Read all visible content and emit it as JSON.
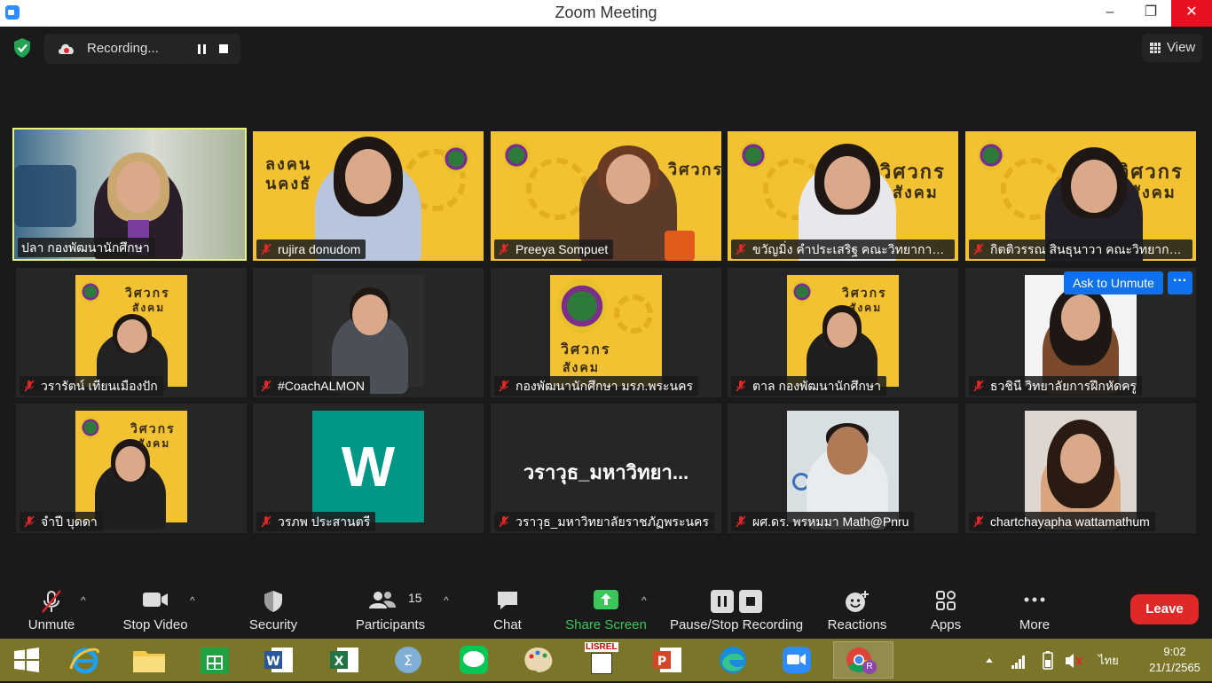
{
  "window": {
    "title": "Zoom Meeting",
    "minimize": "–",
    "maximize": "❐",
    "close": "✕"
  },
  "recording": {
    "label": "Recording..."
  },
  "view_button": {
    "label": "View"
  },
  "tiles": [
    {
      "name": "ปลา  กองพัฒนานักศึกษา",
      "muted": false,
      "active": true
    },
    {
      "name": "rujira donudom",
      "muted": true
    },
    {
      "name": "Preeya Sompuet",
      "muted": true
    },
    {
      "name": "ขวัญมิ่ง คำประเสริฐ คณะวิทยาการจัด...",
      "muted": true
    },
    {
      "name": "กิตติวรรณ สินธุนาวา คณะวิทยาการจั...",
      "muted": true
    },
    {
      "name": "วรารัตน์ เทียนเมืองปัก",
      "muted": true
    },
    {
      "name": "#CoachALMON",
      "muted": true
    },
    {
      "name": "กองพัฒนานักศึกษา มรภ.พระนคร",
      "muted": true
    },
    {
      "name": "ตาล กองพัฒนานักศึกษา",
      "muted": true
    },
    {
      "name": "ธวชินี  วิทยาลัยการฝึกหัดครู",
      "muted": true
    },
    {
      "name": "จำปี บุดดา",
      "muted": true
    },
    {
      "name": "วรภพ ประสานตรี",
      "muted": true,
      "avatar_letter": "W"
    },
    {
      "name": "วราวุธ_มหาวิทยาลัยราชภัฏพระนคร",
      "muted": true,
      "big_name": "วราวุธ_มหาวิทยา..."
    },
    {
      "name": "ผศ.ดร. พรหมมา Math@Pnru",
      "muted": true
    },
    {
      "name": "chartchayapha wattamathum",
      "muted": true
    }
  ],
  "ask_to_unmute": {
    "label": "Ask to Unmute",
    "more": "···"
  },
  "backgrounds": {
    "brand_1": "วิศวกร",
    "brand_2": "สังคม",
    "brand_3": "ลงคน",
    "brand_4": "นคงธั"
  },
  "toolbar": {
    "unmute": "Unmute",
    "stop_video": "Stop Video",
    "security": "Security",
    "participants": "Participants",
    "participants_count": "15",
    "chat": "Chat",
    "share_screen": "Share Screen",
    "pause_stop_recording": "Pause/Stop Recording",
    "reactions": "Reactions",
    "apps": "Apps",
    "more": "More",
    "leave": "Leave",
    "caret": "^"
  },
  "taskbar": {
    "language": "ไทย",
    "time": "9:02",
    "date": "21/1/2565",
    "lisrel_label": "LISREL",
    "chrome_badge": "R"
  },
  "colors": {
    "accent": "#0e72ed",
    "leave": "#e02828",
    "share": "#3cc65a",
    "active_border": "#e8f37a",
    "taskbar": "#7a7528"
  }
}
